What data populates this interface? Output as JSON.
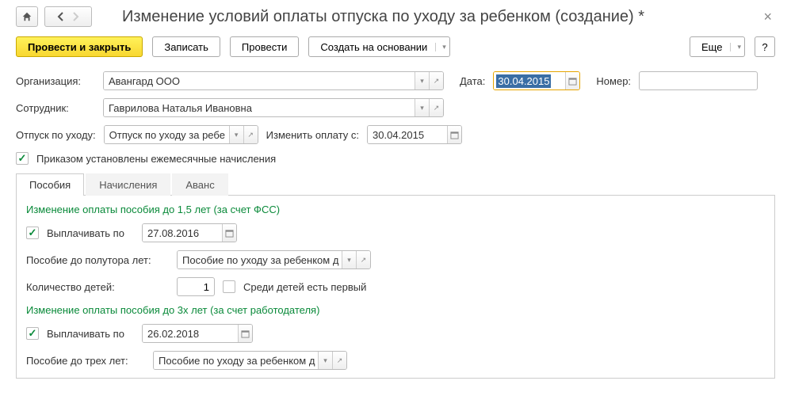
{
  "header": {
    "title": "Изменение условий оплаты отпуска по уходу за ребенком (создание) *"
  },
  "toolbar": {
    "post_close": "Провести и закрыть",
    "save": "Записать",
    "post": "Провести",
    "create_based": "Создать на основании",
    "more": "Еще",
    "help": "?"
  },
  "fields": {
    "org_label": "Организация:",
    "org_value": "Авангард ООО",
    "date_label": "Дата:",
    "date_value": "30.04.2015",
    "number_label": "Номер:",
    "number_value": "",
    "employee_label": "Сотрудник:",
    "employee_value": "Гаврилова Наталья Ивановна",
    "leave_label": "Отпуск по уходу:",
    "leave_value": "Отпуск по уходу за ребе",
    "change_from_label": "Изменить оплату с:",
    "change_from_value": "30.04.2015",
    "order_checkbox_label": "Приказом установлены ежемесячные начисления"
  },
  "tabs": {
    "benefits": "Пособия",
    "accruals": "Начисления",
    "advance": "Аванс"
  },
  "benefits": {
    "section1_title": "Изменение оплаты пособия до 1,5 лет (за счет ФСС)",
    "pay_until_label": "Выплачивать по",
    "pay_until_1": "27.08.2016",
    "benefit_1_5_label": "Пособие до полутора лет:",
    "benefit_1_5_value": "Пособие по уходу за ребенком д",
    "children_count_label": "Количество детей:",
    "children_count_value": "1",
    "first_child_label": "Среди детей есть первый",
    "section2_title": "Изменение оплаты пособия до 3х лет (за счет работодателя)",
    "pay_until_2": "26.02.2018",
    "benefit_3_label": "Пособие до трех лет:",
    "benefit_3_value": "Пособие по уходу за ребенком д"
  }
}
